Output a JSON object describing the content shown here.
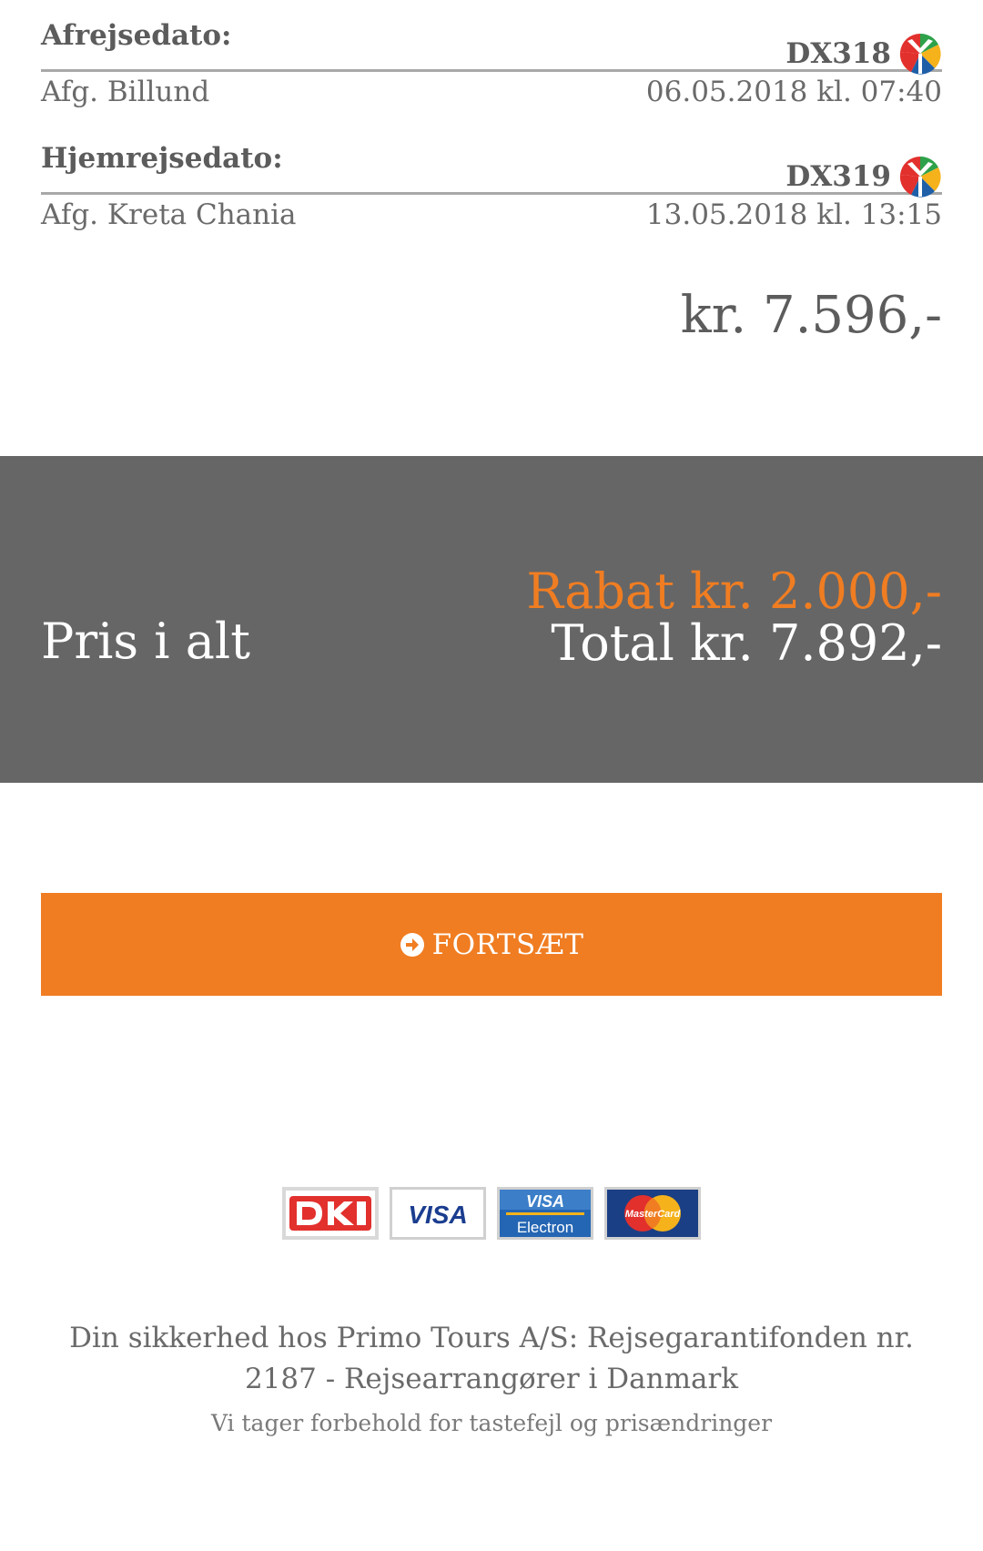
{
  "departure": {
    "label": "Afrejsedato:",
    "flight_code": "DX318",
    "airline_icon": "airline-logo-icon",
    "from": "Afg. Billund",
    "datetime": "06.05.2018 kl. 07:40"
  },
  "return": {
    "label": "Hjemrejsedato:",
    "flight_code": "DX319",
    "airline_icon": "airline-logo-icon",
    "from": "Afg. Kreta Chania",
    "datetime": "13.05.2018 kl. 13:15"
  },
  "trip_price": "kr. 7.596,-",
  "summary": {
    "label": "Pris i alt",
    "discount": "Rabat kr. 2.000,-",
    "total": "Total kr. 7.892,-"
  },
  "continue_button": {
    "label": "FORTSÆT",
    "icon": "arrow-circle-right-icon"
  },
  "payment_logos": [
    {
      "name": "Dankort",
      "icon": "dankort-logo"
    },
    {
      "name": "VISA",
      "icon": "visa-logo"
    },
    {
      "name": "VISA Electron",
      "icon": "visa-electron-logo"
    },
    {
      "name": "MasterCard",
      "icon": "mastercard-logo"
    }
  ],
  "footer": {
    "security_text": "Din sikkerhed hos Primo Tours A/S: Rejsegarantifonden nr. 2187 - Rejsearrangører i Danmark",
    "disclaimer": "Vi tager forbehold for tastefejl og prisændringer"
  },
  "colors": {
    "accent": "#f07d22",
    "band": "#666666",
    "text": "#666666",
    "divider": "#a8a8a8"
  }
}
